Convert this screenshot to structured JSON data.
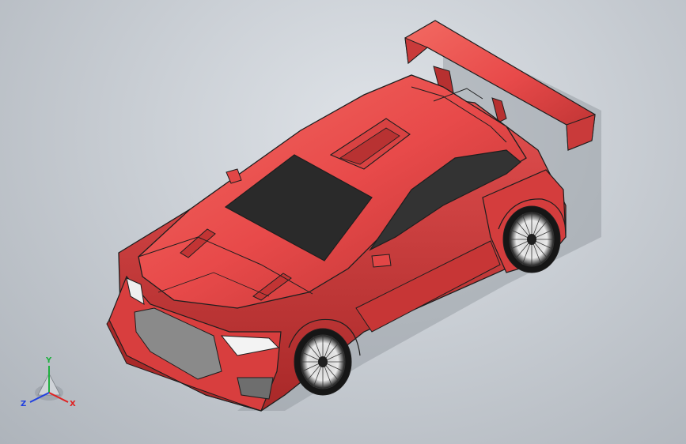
{
  "viewport": {
    "background_top": "#dfe3e8",
    "background_bottom": "#aeb4bb"
  },
  "model": {
    "body_color": "#e84a4a",
    "window_color": "#2a2a2a",
    "wheel_color": "#1b1b1b",
    "outline_color": "#1e1e1e"
  },
  "triad": {
    "x_label": "X",
    "y_label": "Y",
    "z_label": "Z",
    "x_color": "#e02020",
    "y_color": "#20b040",
    "z_color": "#2040e0"
  }
}
